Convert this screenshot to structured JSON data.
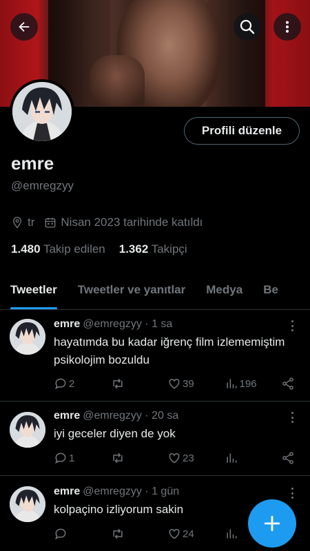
{
  "profile": {
    "name": "emre",
    "handle": "@emregzyy",
    "edit_label": "Profili düzenle",
    "location": "tr",
    "joined": "Nisan 2023 tarihinde katıldı",
    "following_count": "1.480",
    "following_label": "Takip edilen",
    "followers_count": "1.362",
    "followers_label": "Takipçi"
  },
  "tabs": [
    {
      "label": "Tweetler"
    },
    {
      "label": "Tweetler ve yanıtlar"
    },
    {
      "label": "Medya"
    },
    {
      "label": "Be"
    }
  ],
  "tweets": [
    {
      "name": "emre",
      "handle": "@emregzyy",
      "time": "· 1 sa",
      "text": "hayatımda bu kadar iğrenç film izlememiştim psikolojim bozuldu",
      "replies": "2",
      "retweets": "",
      "likes": "39",
      "views": "196"
    },
    {
      "name": "emre",
      "handle": "@emregzyy",
      "time": "· 20 sa",
      "text": "iyi geceler diyen de yok",
      "replies": "1",
      "retweets": "",
      "likes": "23",
      "views": ""
    },
    {
      "name": "emre",
      "handle": "@emregzyy",
      "time": "· 1 gün",
      "text": "kolpaçino izliyorum sakin",
      "replies": "",
      "retweets": "",
      "likes": "24",
      "views": ""
    }
  ],
  "colors": {
    "accent": "#1d9bf0",
    "background": "#000000",
    "muted": "#71767b",
    "text": "#e7e9ea"
  },
  "icons": [
    "back-arrow-icon",
    "search-icon",
    "more-vertical-icon",
    "location-icon",
    "calendar-icon",
    "reply-icon",
    "retweet-icon",
    "like-icon",
    "views-icon",
    "share-icon",
    "plus-icon"
  ]
}
